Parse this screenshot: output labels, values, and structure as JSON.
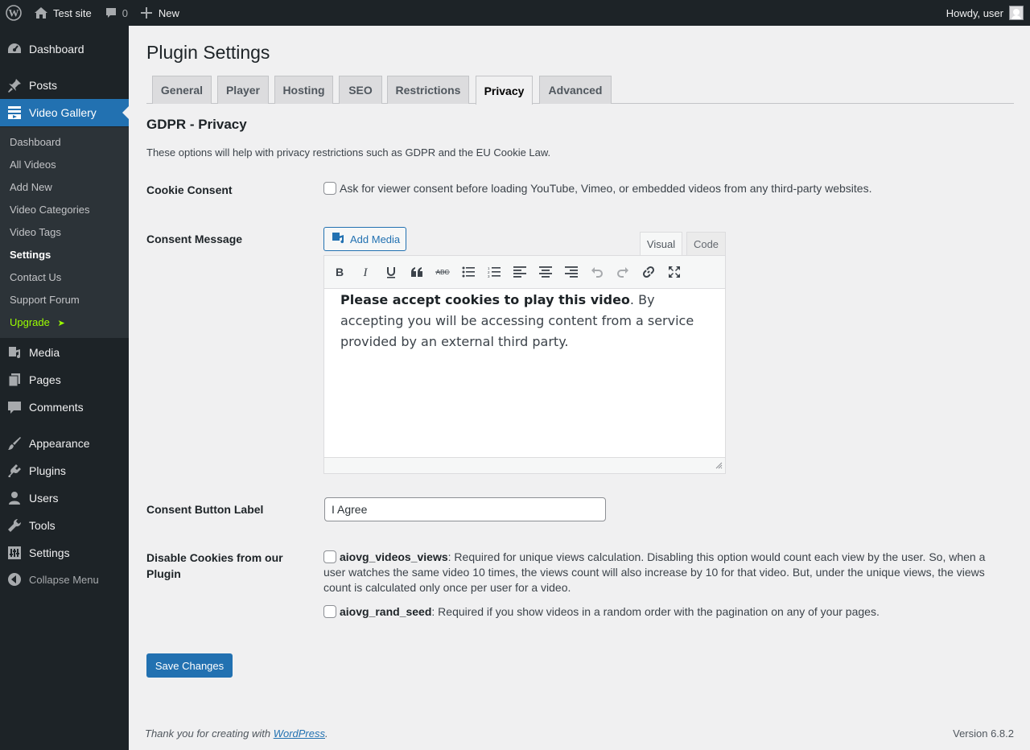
{
  "adminbar": {
    "site_name": "Test site",
    "comments_count": "0",
    "new_label": "New",
    "howdy": "Howdy, user"
  },
  "sidebar": {
    "menu": [
      {
        "label": "Dashboard",
        "icon": "dashboard-icon"
      },
      {
        "label": "Posts",
        "icon": "pin-icon"
      },
      {
        "label": "Video Gallery",
        "icon": "video-gallery-icon"
      },
      {
        "label": "Media",
        "icon": "media-icon"
      },
      {
        "label": "Pages",
        "icon": "pages-icon"
      },
      {
        "label": "Comments",
        "icon": "comment-icon"
      },
      {
        "label": "Appearance",
        "icon": "brush-icon"
      },
      {
        "label": "Plugins",
        "icon": "plug-icon"
      },
      {
        "label": "Users",
        "icon": "user-icon"
      },
      {
        "label": "Tools",
        "icon": "wrench-icon"
      },
      {
        "label": "Settings",
        "icon": "settings-sliders-icon"
      }
    ],
    "submenu": [
      "Dashboard",
      "All Videos",
      "Add New",
      "Video Categories",
      "Video Tags",
      "Settings",
      "Contact Us",
      "Support Forum",
      "Upgrade"
    ],
    "upgrade_arrow": "➤",
    "collapse_label": "Collapse Menu",
    "accent_color": "#2271b1",
    "upgrade_color": "#9cff00"
  },
  "page": {
    "title": "Plugin Settings",
    "tabs": [
      "General",
      "Player",
      "Hosting",
      "SEO",
      "Restrictions",
      "Privacy",
      "Advanced"
    ],
    "active_tab": "Privacy",
    "section_title": "GDPR - Privacy",
    "section_description": "These options will help with privacy restrictions such as GDPR and the EU Cookie Law."
  },
  "fields": {
    "cookie_consent": {
      "label": "Cookie Consent",
      "checkbox_text": "Ask for viewer consent before loading YouTube, Vimeo, or embedded videos from any third-party websites.",
      "checked": false
    },
    "consent_message": {
      "label": "Consent Message",
      "add_media": "Add Media",
      "tab_visual": "Visual",
      "tab_code": "Code",
      "toolbar": [
        "bold-icon",
        "italic-icon",
        "underline-icon",
        "blockquote-icon",
        "strikethrough-icon",
        "bullet-list-icon",
        "numbered-list-icon",
        "align-left-icon",
        "align-center-icon",
        "align-right-icon",
        "undo-icon",
        "redo-icon",
        "link-icon",
        "fullscreen-icon"
      ],
      "content_bold": "Please accept cookies to play this video",
      "content_rest": ". By accepting you will be accessing content from a service provided by an external third party."
    },
    "consent_button": {
      "label": "Consent Button Label",
      "value": "I Agree"
    },
    "disable_cookies": {
      "label": "Disable Cookies from our Plugin",
      "options": [
        {
          "name": "aiovg_videos_views",
          "description": ": Required for unique views calculation. Disabling this option would count each view by the user. So, when a user watches the same video 10 times, the views count will also increase by 10 for that video. But, under the unique views, the views count is calculated only once per user for a video.",
          "checked": false
        },
        {
          "name": "aiovg_rand_seed",
          "description": ": Required if you show videos in a random order with the pagination on any of your pages.",
          "checked": false
        }
      ]
    }
  },
  "save_button": "Save Changes",
  "footer": {
    "thanks_prefix": "Thank you for creating with ",
    "wordpress_link": "WordPress",
    "thanks_suffix": ".",
    "version": "Version 6.8.2"
  }
}
